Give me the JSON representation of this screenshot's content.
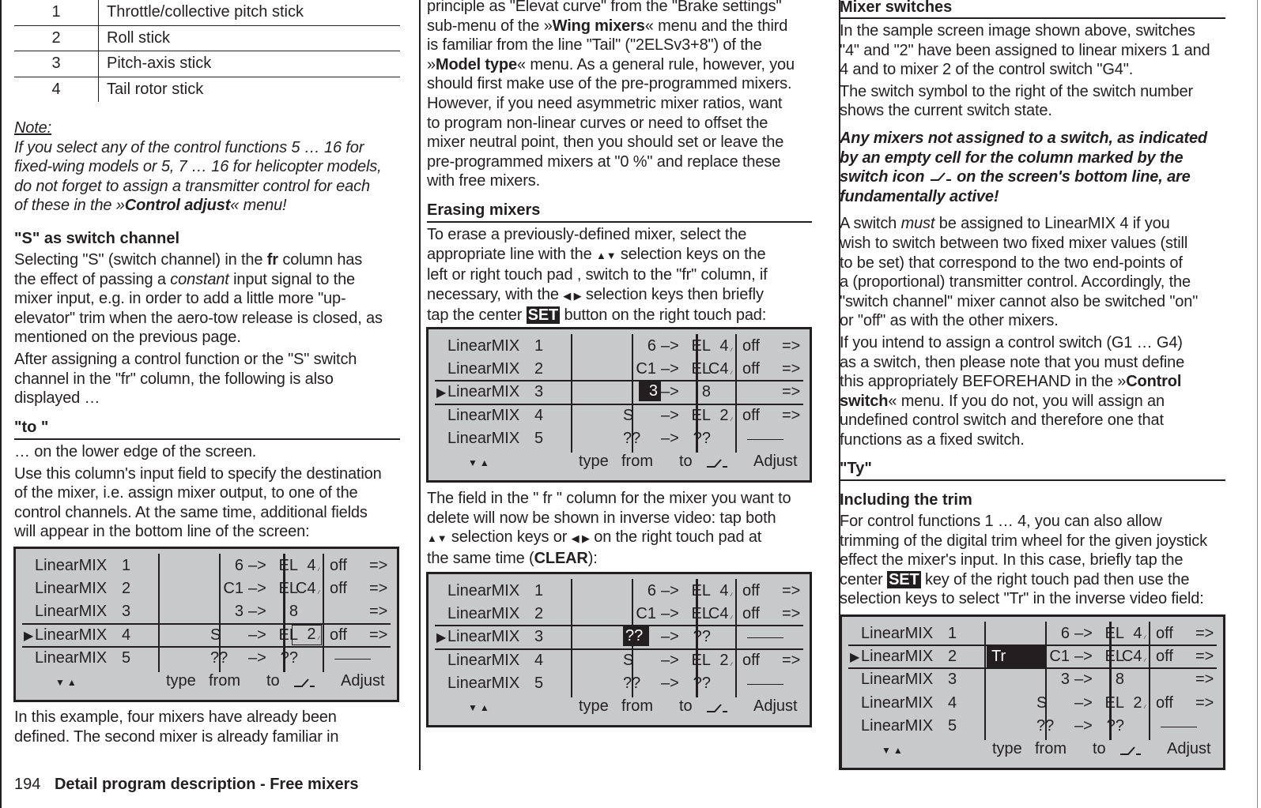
{
  "page": {
    "number": "194",
    "footer_title": "Detail program description - Free mixers"
  },
  "left": {
    "stick_table": [
      {
        "num": "1",
        "text": "Throttle/collective pitch stick"
      },
      {
        "num": "2",
        "text": "Roll stick"
      },
      {
        "num": "3",
        "text": "Pitch-axis stick"
      },
      {
        "num": "4",
        "text": "Tail rotor stick"
      }
    ],
    "note_label": "Note:",
    "note_lines": [
      "If you select any of the control functions 5 … 16 for",
      "fixed-wing models or 5, 7 … 16 for helicopter models,",
      "do not forget to assign a transmitter control for each"
    ],
    "note_last_pre": "of these in the »",
    "note_last_bold": "Control adjust",
    "note_last_post": "« menu!",
    "s_heading": "\"S\" as switch channel",
    "s_p1_a": "Selecting \"S\" (switch channel) in the ",
    "s_p1_b": "fr",
    "s_p1_c": " column has",
    "s_p1_d": "the effect of passing a ",
    "s_p1_e": "constant",
    "s_p1_f": " input signal to the",
    "s_p1_rest": [
      "mixer input, e.g. in order to add a little more \"up-",
      "elevator\" trim when the aero-tow release is closed, as",
      "mentioned on the previous page."
    ],
    "s_p2": [
      "After assigning a control function or the \"S\" switch",
      "channel in the \"fr\" column, the following is also",
      "displayed …"
    ],
    "to_heading": "\"to \"",
    "to_p1": "… on the lower edge of the screen.",
    "to_p2": [
      "Use this column's input field to specify the destination",
      "of the mixer, i.e. assign mixer output, to one of the",
      "control channels. At the same time, additional fields",
      "will appear in the bottom line of the screen:"
    ],
    "after_screen": [
      "In this example, four mixers have already been",
      "defined. The second mixer is already familiar in"
    ]
  },
  "middle": {
    "intro_lines": [
      "principle as \"Elevat curve\" from the \"Brake settings\""
    ],
    "intro_l2_a": "sub-menu of the »",
    "intro_l2_b": "Wing mixers",
    "intro_l2_c": "« menu and the third",
    "intro_l3": "is familiar from the line \"Tail\" (\"2ELSv3+8\") of the",
    "intro_l4_a": "»",
    "intro_l4_b": "Model type",
    "intro_l4_c": "« menu. As a general rule, however, you",
    "intro_rest": [
      "should first make use of the pre-programmed mixers.",
      "However, if you need asymmetric mixer ratios, want",
      "to program non-linear curves or need to offset the",
      "mixer neutral point, then you should set or leave the",
      "pre-programmed mixers at \"0 %\" and replace these",
      "with free mixers."
    ],
    "erase_heading": "Erasing mixers",
    "erase_l1": "To erase a previously-defined mixer, select the",
    "erase_l2_a": "appropriate line with the ",
    "erase_l2_keys": "▲▼",
    "erase_l2_b": " selection keys on the",
    "erase_l3": "left or right touch pad , switch to the \"fr\" column, if",
    "erase_l4_a": "necessary, with the ",
    "erase_l4_keys": "◀ ▶",
    "erase_l4_b": " selection keys then briefly",
    "erase_l5_a": "tap the center ",
    "erase_l5_set": "SET",
    "erase_l5_b": " button on the right touch pad:",
    "field_l1": "The field in the \" fr \" column for the mixer you want to",
    "field_l2": "delete will now be shown in inverse video: tap both",
    "field_l3_keys1": "▲▼",
    "field_l3_a": " selection keys or ",
    "field_l3_keys2": "◀ ▶",
    "field_l3_b": " on the right touch pad at",
    "field_l4_a": "the same time (",
    "field_l4_b": "CLEAR",
    "field_l4_c": "):"
  },
  "right": {
    "switches_heading": "Mixer switches",
    "switches_p1": [
      "In the sample screen image shown above, switches",
      "\"4\" and \"2\" have been assigned to linear mixers 1 and",
      "4 and to mixer 2 of the control switch \"G4\"."
    ],
    "switches_p2": [
      "The switch symbol to the right of the switch number",
      "shows the current switch state."
    ],
    "warn_lines": [
      "Any mixers not assigned to a switch, as indicated",
      "by an empty cell for the column marked by the"
    ],
    "warn_l3_a": "switch icon ",
    "warn_l3_b": " on the screen's bottom line, are",
    "warn_l4": "fundamentally active!",
    "must_l1_a": "A switch ",
    "must_l1_b": "must",
    "must_l1_c": " be assigned to LinearMIX 4 if you",
    "must_rest": [
      "wish to switch between two fixed mixer values (still",
      "to be set) that correspond to the two end-points of",
      "a (proportional) transmitter control. Accordingly, the",
      "\"switch channel\" mixer cannot also be switched \"on\"",
      "or \"off\" as with the other mixers."
    ],
    "ctrl_lines": [
      "If you intend to assign a control switch (G1 … G4)",
      "as a switch, then please note that you must define"
    ],
    "ctrl_l3_a": "this appropriately BEFOREHAND in the »",
    "ctrl_l3_b": "Control",
    "ctrl_l4_a": "switch",
    "ctrl_l4_b": "« menu. If you do not, you will assign an",
    "ctrl_rest": [
      "undefined control switch and therefore one that",
      "functions as a fixed switch."
    ],
    "ty_heading": "\"Ty\"",
    "trim_heading": "Including the trim",
    "trim_l1": "For control functions 1 … 4, you can also allow",
    "trim_l2": "trimming of the digital trim wheel for the given joystick",
    "trim_l3": "effect the mixer's input. In this case, briefly tap the",
    "trim_l4_a": "center ",
    "trim_l4_set": "SET",
    "trim_l4_b": " key of the right touch pad then use the",
    "trim_l5": "selection keys to select \"Tr\" in the inverse video field:"
  },
  "screen_footer": {
    "nav": "▼▲",
    "type": "type",
    "from": "from",
    "to": "to",
    "adjust": "Adjust"
  },
  "screens": [
    {
      "selected": 4,
      "rows": [
        {
          "name": "LinearMIX",
          "num": "1",
          "type": "",
          "from": "6",
          "to": "EL",
          "sw": "4",
          "state": "off",
          "go": "=>",
          "empty": false
        },
        {
          "name": "LinearMIX",
          "num": "2",
          "type": "",
          "from": "C1",
          "to": "EL",
          "sw": "C4",
          "state": "off",
          "go": "=>",
          "empty": false
        },
        {
          "name": "LinearMIX",
          "num": "3",
          "type": "",
          "from": "3",
          "to": "8",
          "sw": "",
          "state": "",
          "go": "=>",
          "empty": false
        },
        {
          "name": "LinearMIX",
          "num": "4",
          "type": "",
          "from": "S",
          "to": "EL",
          "sw": "2",
          "state": "off",
          "go": "=>",
          "empty": false
        },
        {
          "name": "LinearMIX",
          "num": "5",
          "type": "",
          "from": "??",
          "to": "??",
          "sw": "",
          "state": "",
          "go": "",
          "empty": true
        }
      ]
    },
    {
      "selected": 3,
      "rows": [
        {
          "name": "LinearMIX",
          "num": "1",
          "type": "",
          "from": "6",
          "to": "EL",
          "sw": "4",
          "state": "off",
          "go": "=>",
          "empty": false
        },
        {
          "name": "LinearMIX",
          "num": "2",
          "type": "",
          "from": "C1",
          "to": "EL",
          "sw": "C4",
          "state": "off",
          "go": "=>",
          "empty": false
        },
        {
          "name": "LinearMIX",
          "num": "3",
          "type": "",
          "from": "3",
          "to": "8",
          "sw": "",
          "state": "",
          "go": "=>",
          "empty": false
        },
        {
          "name": "LinearMIX",
          "num": "4",
          "type": "",
          "from": "S",
          "to": "EL",
          "sw": "2",
          "state": "off",
          "go": "=>",
          "empty": false
        },
        {
          "name": "LinearMIX",
          "num": "5",
          "type": "",
          "from": "??",
          "to": "??",
          "sw": "",
          "state": "",
          "go": "",
          "empty": true
        }
      ]
    },
    {
      "selected": 3,
      "rows": [
        {
          "name": "LinearMIX",
          "num": "1",
          "type": "",
          "from": "6",
          "to": "EL",
          "sw": "4",
          "state": "off",
          "go": "=>",
          "empty": false
        },
        {
          "name": "LinearMIX",
          "num": "2",
          "type": "",
          "from": "C1",
          "to": "EL",
          "sw": "C4",
          "state": "off",
          "go": "=>",
          "empty": false
        },
        {
          "name": "LinearMIX",
          "num": "3",
          "type": "",
          "from": "??",
          "to": "??",
          "sw": "",
          "state": "",
          "go": "",
          "empty": true
        },
        {
          "name": "LinearMIX",
          "num": "4",
          "type": "",
          "from": "S",
          "to": "EL",
          "sw": "2",
          "state": "off",
          "go": "=>",
          "empty": false
        },
        {
          "name": "LinearMIX",
          "num": "5",
          "type": "",
          "from": "??",
          "to": "??",
          "sw": "",
          "state": "",
          "go": "",
          "empty": true
        }
      ]
    },
    {
      "selected": 2,
      "rows": [
        {
          "name": "LinearMIX",
          "num": "1",
          "type": "",
          "from": "6",
          "to": "EL",
          "sw": "4",
          "state": "off",
          "go": "=>",
          "empty": false
        },
        {
          "name": "LinearMIX",
          "num": "2",
          "type": "Tr",
          "from": "C1",
          "to": "EL",
          "sw": "C4",
          "state": "off",
          "go": "=>",
          "empty": false
        },
        {
          "name": "LinearMIX",
          "num": "3",
          "type": "",
          "from": "3",
          "to": "8",
          "sw": "",
          "state": "",
          "go": "=>",
          "empty": false
        },
        {
          "name": "LinearMIX",
          "num": "4",
          "type": "",
          "from": "S",
          "to": "EL",
          "sw": "2",
          "state": "off",
          "go": "=>",
          "empty": false
        },
        {
          "name": "LinearMIX",
          "num": "5",
          "type": "",
          "from": "??",
          "to": "??",
          "sw": "",
          "state": "",
          "go": "",
          "empty": true
        }
      ]
    }
  ]
}
